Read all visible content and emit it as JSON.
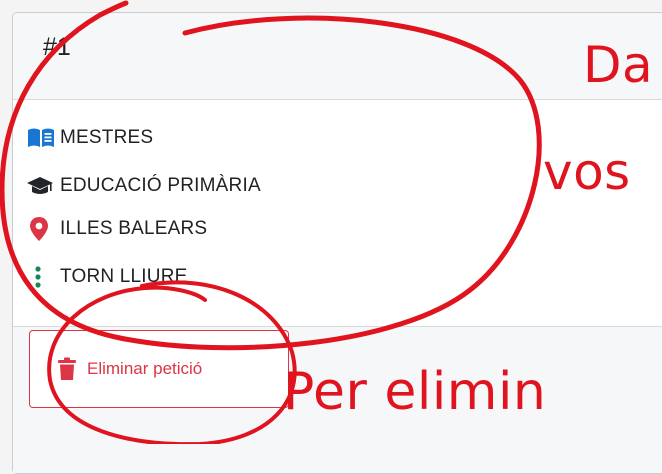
{
  "card": {
    "number": "#1",
    "items": [
      {
        "icon": "book-open-icon",
        "label": "MESTRES"
      },
      {
        "icon": "graduation-cap-icon",
        "label": "EDUCACIÓ PRIMÀRIA"
      },
      {
        "icon": "map-marker-icon",
        "label": "ILLES BALEARS"
      },
      {
        "icon": "ellipsis-vertical-icon",
        "label": "TORN LLIURE"
      }
    ],
    "delete_button_label": "Eliminar petició"
  },
  "annotations": {
    "text_top": "Da",
    "text_middle": "vos",
    "text_bottom": "Per elimin"
  },
  "colors": {
    "accent_blue": "#1976d2",
    "icon_dark": "#212529",
    "marker_red": "#dc3545",
    "ellipsis_green": "#198754",
    "annotation_red": "#e0141e"
  }
}
